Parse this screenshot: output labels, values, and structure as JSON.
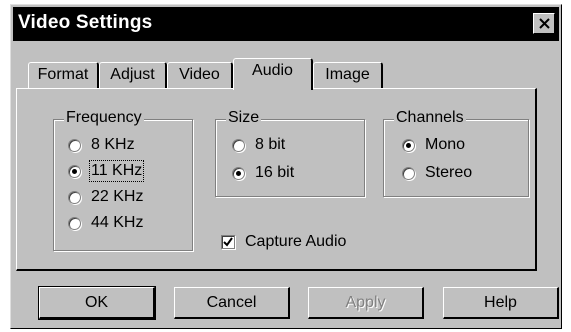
{
  "window": {
    "title": "Video Settings"
  },
  "tabs": [
    {
      "label": "Format"
    },
    {
      "label": "Adjust"
    },
    {
      "label": "Video"
    },
    {
      "label": "Audio",
      "active": true
    },
    {
      "label": "Image"
    }
  ],
  "frequency": {
    "legend": "Frequency",
    "options": [
      {
        "label": "8 KHz",
        "selected": false
      },
      {
        "label": "11 KHz",
        "selected": true
      },
      {
        "label": "22 KHz",
        "selected": false
      },
      {
        "label": "44 KHz",
        "selected": false
      }
    ]
  },
  "size": {
    "legend": "Size",
    "options": [
      {
        "label": "8 bit",
        "selected": false
      },
      {
        "label": "16 bit",
        "selected": true
      }
    ]
  },
  "channels": {
    "legend": "Channels",
    "options": [
      {
        "label": "Mono",
        "selected": true
      },
      {
        "label": "Stereo",
        "selected": false
      }
    ]
  },
  "capture": {
    "label": "Capture Audio",
    "checked": true
  },
  "buttons": {
    "ok": "OK",
    "cancel": "Cancel",
    "apply": "Apply",
    "help": "Help"
  }
}
